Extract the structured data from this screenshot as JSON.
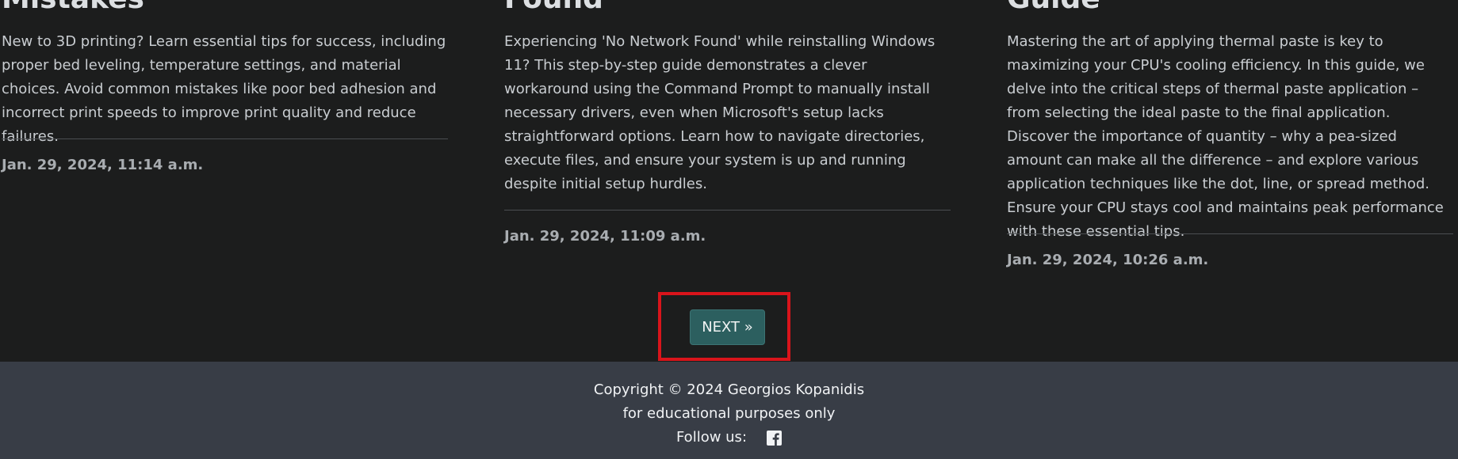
{
  "cards": [
    {
      "title": "Mistakes",
      "description": "New to 3D printing? Learn essential tips for success, including proper bed leveling, temperature settings, and material choices. Avoid common mistakes like poor bed adhesion and incorrect print speeds to improve print quality and reduce failures.",
      "date": "Jan. 29, 2024, 11:14 a.m."
    },
    {
      "title": "Found",
      "description": "Experiencing 'No Network Found' while reinstalling Windows 11? This step-by-step guide demonstrates a clever workaround using the Command Prompt to manually install necessary drivers, even when Microsoft's setup lacks straightforward options. Learn how to navigate directories, execute files, and ensure your system is up and running despite initial setup hurdles.",
      "date": "Jan. 29, 2024, 11:09 a.m."
    },
    {
      "title": "Guide",
      "description": "Mastering the art of applying thermal paste is key to maximizing your CPU's cooling efficiency. In this guide, we delve into the critical steps of thermal paste application – from selecting the ideal paste to the final application. Discover the importance of quantity – why a pea-sized amount can make all the difference – and explore various application techniques like the dot, line, or spread method. Ensure your CPU stays cool and maintains peak performance with these essential tips.",
      "date": "Jan. 29, 2024, 10:26 a.m."
    }
  ],
  "pagination": {
    "next_label": "NEXT »"
  },
  "footer": {
    "copyright": "Copyright © 2024 Georgios Kopanidis",
    "purpose": "for educational purposes only",
    "follow_label": "Follow us:",
    "social_icon": "facebook-icon"
  },
  "colors": {
    "page_background": "#1c1d1d",
    "footer_background": "#383d46",
    "button_background": "#2c5f5f",
    "highlight": "#d9141b"
  }
}
